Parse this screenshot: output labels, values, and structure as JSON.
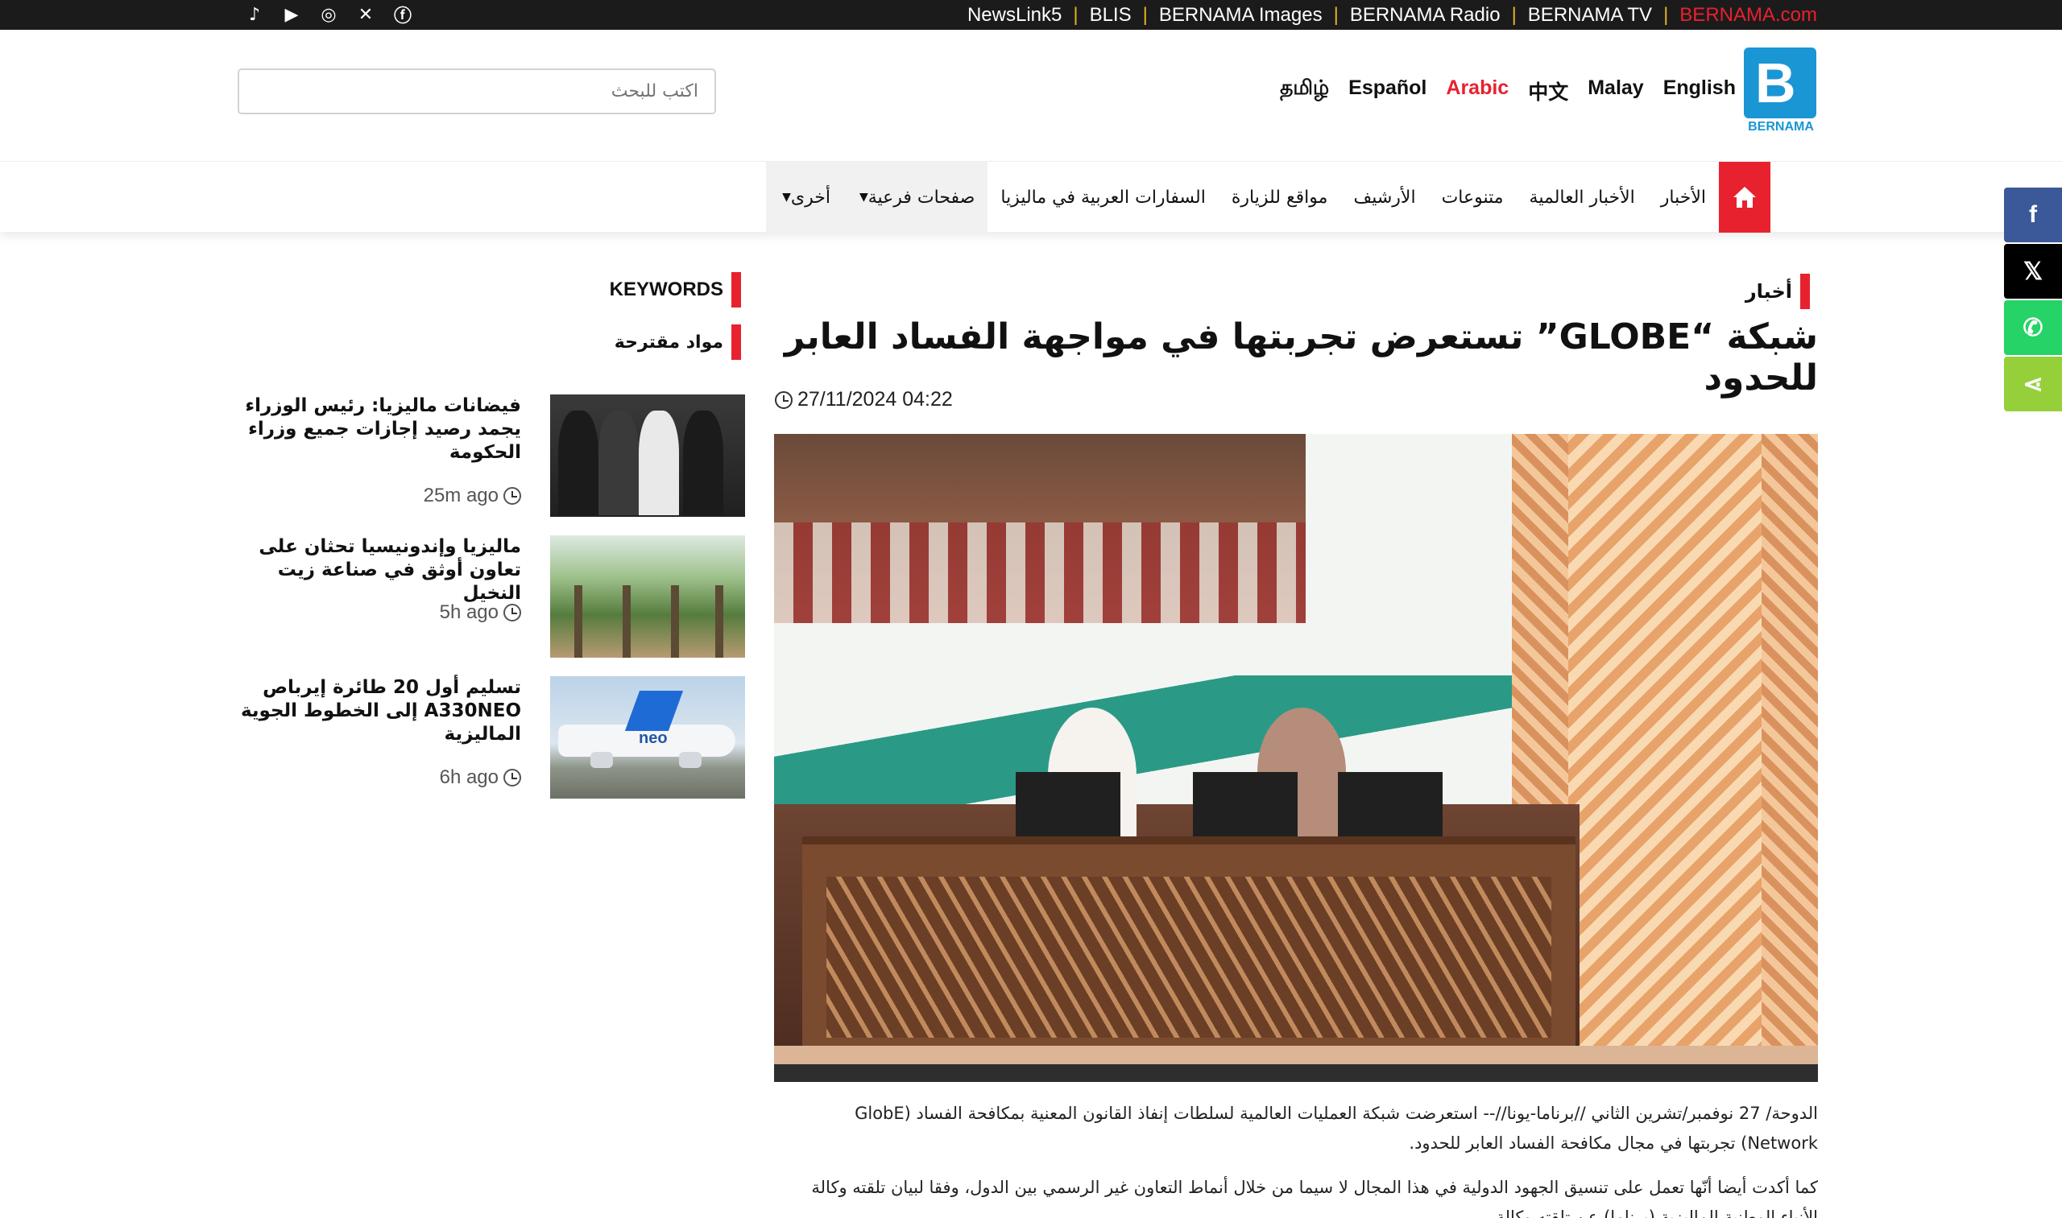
{
  "topbar": {
    "social_icons": [
      "tiktok-icon",
      "youtube-icon",
      "instagram-icon",
      "x-icon",
      "facebook-icon"
    ],
    "links": [
      "NewsLink5",
      "BLIS",
      "BERNAMA Images",
      "BERNAMA Radio",
      "BERNAMA TV",
      "BERNAMA.com"
    ],
    "separator": "|"
  },
  "header": {
    "search_placeholder": "اكتب للبحث",
    "languages": [
      "English",
      "Malay",
      "中文",
      "Arabic",
      "Español",
      "தமிழ்"
    ],
    "active_language": "Arabic",
    "logo_mark": "B",
    "logo_text": "BERNAMA"
  },
  "nav": {
    "items": [
      "الأخبار",
      "الأخبار العالمية",
      "متنوعات",
      "الأرشيف",
      "مواقع للزيارة",
      "السفارات العربية في ماليزيا",
      "صفحات فرعية",
      "أخرى"
    ],
    "home_icon": "home-icon"
  },
  "share": {
    "buttons": [
      "facebook",
      "x",
      "whatsapp",
      "share"
    ],
    "icons": [
      "f",
      "𝕏",
      "✆",
      "⋖"
    ],
    "colors": [
      "#3b5998",
      "#000000",
      "#25d366",
      "#95d03a"
    ]
  },
  "article": {
    "section": "أخبار",
    "title": "شبكة “GLOBE” تستعرض تجربتها في مواجهة الفساد العابر للحدود",
    "date": "27/11/2024 04:22",
    "paragraph1": "الدوحة/ 27 نوفمبر/تشرين الثاني //برناما-يونا//-- استعرضت شبكة العمليات العالمية لسلطات إنفاذ القانون المعنية بمكافحة الفساد (GlobE Network) تجربتها في مجال مكافحة الفساد العابر للحدود.",
    "paragraph2": "كما أكدت أيضا أنّها تعمل على تنسيق الجهود الدولية في هذا المجال لا سيما من خلال أنماط التعاون غير الرسمي بين الدول، وفقا لبيان تلقته وكالة الأنباء الوطنية الماليزية (برناما) عن تلقته وكالة..."
  },
  "sidebar": {
    "keywords_label": "KEYWORDS",
    "suggested_label": "مواد مقترحة",
    "cards": [
      {
        "title": "فيضانات ماليزيا: رئيس الوزراء يجمد رصيد إجازات جميع وزراء الحكومة",
        "ago": "25m ago"
      },
      {
        "title": "ماليزيا وإندونيسيا تحثان على تعاون أوثق في صناعة زيت النخيل",
        "ago": "5h ago"
      },
      {
        "title": "تسليم أول 20 طائرة إيرباص A330NEO إلى الخطوط الجوية الماليزية",
        "ago": "6h ago"
      }
    ],
    "plane_logo": "neo"
  },
  "colors": {
    "accent_red": "#e8212e",
    "brand_blue": "#1a96d4",
    "topbar_bg": "#1b1b1b",
    "separator_gold": "#e6b422"
  }
}
